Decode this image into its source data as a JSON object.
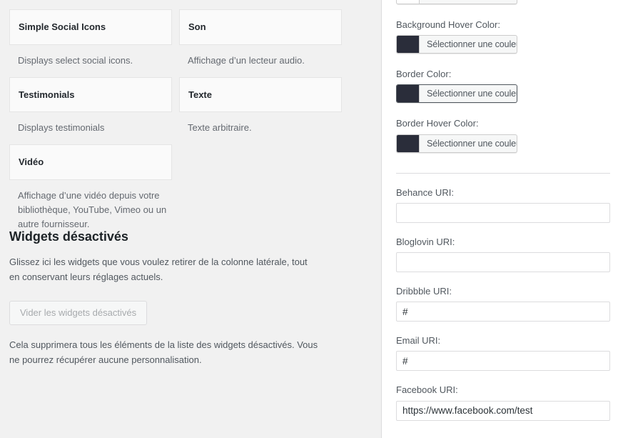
{
  "left_pane": {
    "widget_columns": [
      {
        "items": [
          {
            "title": "Simple Social Icons",
            "description": "Displays select social icons."
          },
          {
            "title": "Testimonials",
            "description": "Displays testimonials"
          },
          {
            "title": "Vidéo",
            "description": "Affichage d’une vidéo depuis votre bibliothèque, YouTube, Vimeo ou un autre fournisseur."
          }
        ]
      },
      {
        "items": [
          {
            "title": "Son",
            "description": "Affichage d’un lecteur audio."
          },
          {
            "title": "Texte",
            "description": "Texte arbitraire."
          }
        ]
      }
    ],
    "inactive_section": {
      "heading": "Widgets désactivés",
      "intro": "Glissez ici les widgets que vous voulez retirer de la colonne latérale, tout en conservant leurs réglages actuels.",
      "clear_button_label": "Vider les widgets désactivés",
      "warning": "Cela supprimera tous les éléments de la liste des widgets désactivés. Vous ne pourrez récupérer aucune personnalisation."
    }
  },
  "right_pane": {
    "color_picker_button_label": "Sélectionner une couleur",
    "color_fields": [
      {
        "label": "",
        "swatch": "#ffffff",
        "focused": false,
        "clipped": true
      },
      {
        "label": "Background Hover Color:",
        "swatch": "#2a2d3a",
        "focused": false,
        "clipped": false
      },
      {
        "label": "Border Color:",
        "swatch": "#2a2d3a",
        "focused": true,
        "clipped": false
      },
      {
        "label": "Border Hover Color:",
        "swatch": "#2a2d3a",
        "focused": false,
        "clipped": false
      }
    ],
    "uri_fields": [
      {
        "label": "Behance URI:",
        "value": ""
      },
      {
        "label": "Bloglovin URI:",
        "value": ""
      },
      {
        "label": "Dribbble URI:",
        "value": "#"
      },
      {
        "label": "Email URI:",
        "value": "#"
      },
      {
        "label": "Facebook URI:",
        "value": "https://www.facebook.com/test"
      }
    ]
  },
  "colors": {
    "page_background": "#f1f1f1",
    "panel_background": "#ffffff",
    "card_background": "#fafafa",
    "card_border": "#e5e5e5",
    "divider": "#dcdcde",
    "heading_text": "#1d2327",
    "body_text": "#50575e",
    "muted_text": "#646970",
    "disabled_text": "#a7aaad",
    "swatch_dark": "#2a2d3a"
  }
}
